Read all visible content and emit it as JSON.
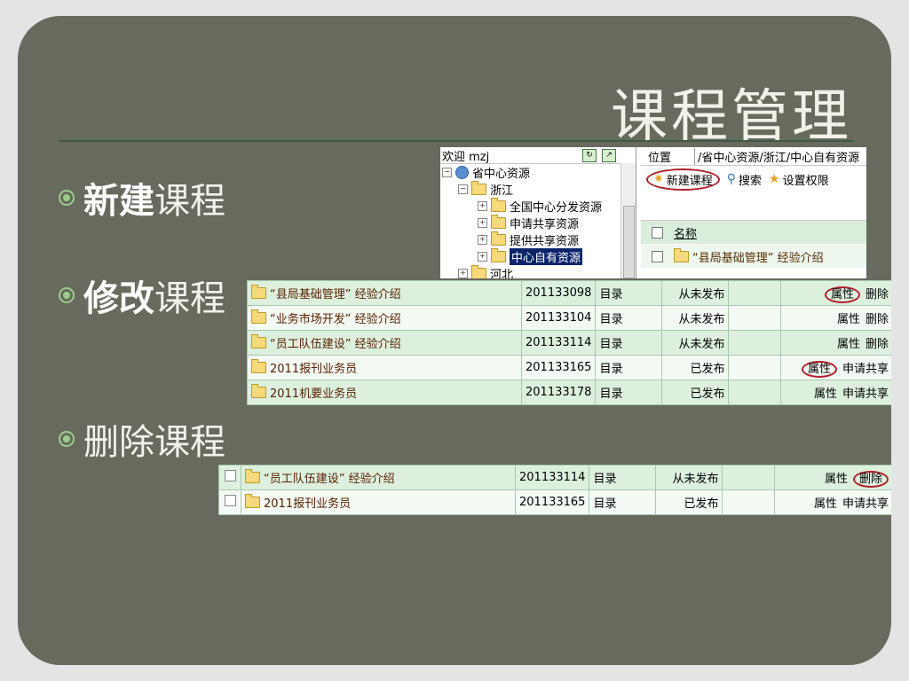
{
  "slide": {
    "title": "课程管理",
    "bullets": [
      {
        "bold": "新建",
        "light": "课程"
      },
      {
        "bold": "修改",
        "light": "课程"
      },
      {
        "bold": "",
        "light": "删除课程"
      }
    ]
  },
  "explorer": {
    "welcome": "欢迎 mzj",
    "tree": [
      {
        "label": "省中心资源"
      },
      {
        "label": "浙江"
      },
      {
        "label": "全国中心分发资源"
      },
      {
        "label": "申请共享资源"
      },
      {
        "label": "提供共享资源"
      },
      {
        "label": "中心自有资源"
      },
      {
        "label": "河北"
      }
    ],
    "location_label": "位置",
    "location_value": "/省中心资源/浙江/中心自有资源",
    "toolbar": {
      "new": "新建课程",
      "search": "搜索",
      "permissions": "设置权限"
    },
    "column_name": "名称",
    "first_item": "“县局基础管理” 经验介绍"
  },
  "table_edit": [
    {
      "name": "“县局基础管理” 经验介绍",
      "id": "201133098",
      "type": "目录",
      "status": "从未发布",
      "op1": "属性",
      "op2": "删除"
    },
    {
      "name": "“业务市场开发” 经验介绍",
      "id": "201133104",
      "type": "目录",
      "status": "从未发布",
      "op1": "属性",
      "op2": "删除"
    },
    {
      "name": "“员工队伍建设” 经验介绍",
      "id": "201133114",
      "type": "目录",
      "status": "从未发布",
      "op1": "属性",
      "op2": "删除"
    },
    {
      "name": "2011报刊业务员",
      "id": "201133165",
      "type": "目录",
      "status": "已发布",
      "op1": "属性",
      "op2": "申请共享"
    },
    {
      "name": "2011机要业务员",
      "id": "201133178",
      "type": "目录",
      "status": "已发布",
      "op1": "属性",
      "op2": "申请共享"
    }
  ],
  "table_delete": [
    {
      "name": "“员工队伍建设” 经验介绍",
      "id": "201133114",
      "type": "目录",
      "status": "从未发布",
      "op1": "属性",
      "op2": "删除"
    },
    {
      "name": "2011报刊业务员",
      "id": "201133165",
      "type": "目录",
      "status": "已发布",
      "op1": "属性",
      "op2": "申请共享"
    }
  ]
}
